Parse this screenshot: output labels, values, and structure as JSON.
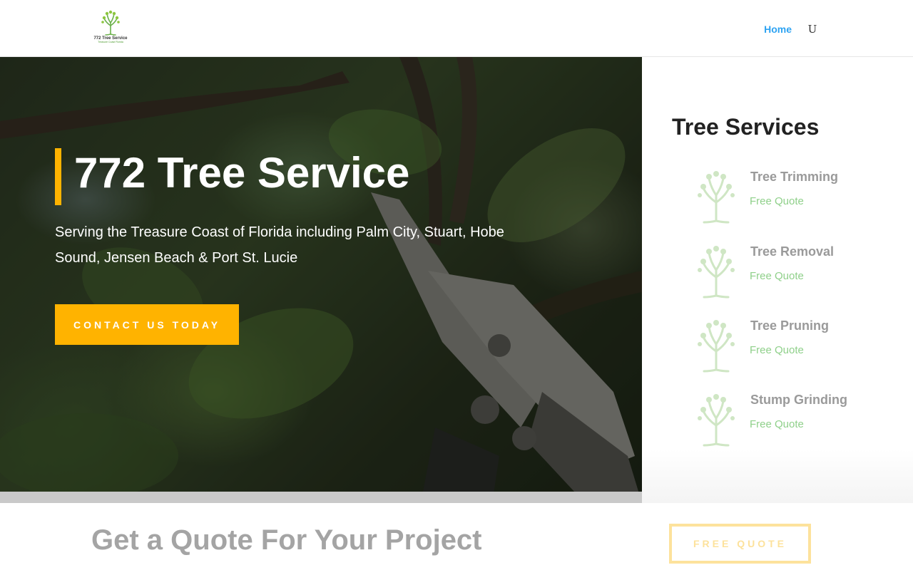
{
  "header": {
    "logo": {
      "brand": "772 Tree Service",
      "tagline": "Treasure Coast Florida"
    },
    "nav": {
      "home_label": "Home",
      "menu_glyph": "U"
    }
  },
  "hero": {
    "title": "772 Tree Service",
    "subtitle": "Serving the Treasure Coast of Florida including Palm City, Stuart, Hobe Sound, Jensen Beach & Port St. Lucie",
    "cta_label": "CONTACT US TODAY"
  },
  "services": {
    "title": "Tree Services",
    "items": [
      {
        "name": "Tree Trimming",
        "link": "Free Quote",
        "icon": "tree-icon"
      },
      {
        "name": "Tree Removal",
        "link": "Free Quote",
        "icon": "tree-icon"
      },
      {
        "name": "Tree Pruning",
        "link": "Free Quote",
        "icon": "tree-icon"
      },
      {
        "name": "Stump Grinding",
        "link": "Free Quote",
        "icon": "tree-icon"
      }
    ]
  },
  "quote_band": {
    "title": "Get a Quote For Your Project",
    "button_label": "FREE QUOTE"
  },
  "colors": {
    "accent": "#ffb300",
    "link_blue": "#2ea3f2",
    "service_green": "#8fd08a",
    "faded_gold": "#fde29c"
  }
}
